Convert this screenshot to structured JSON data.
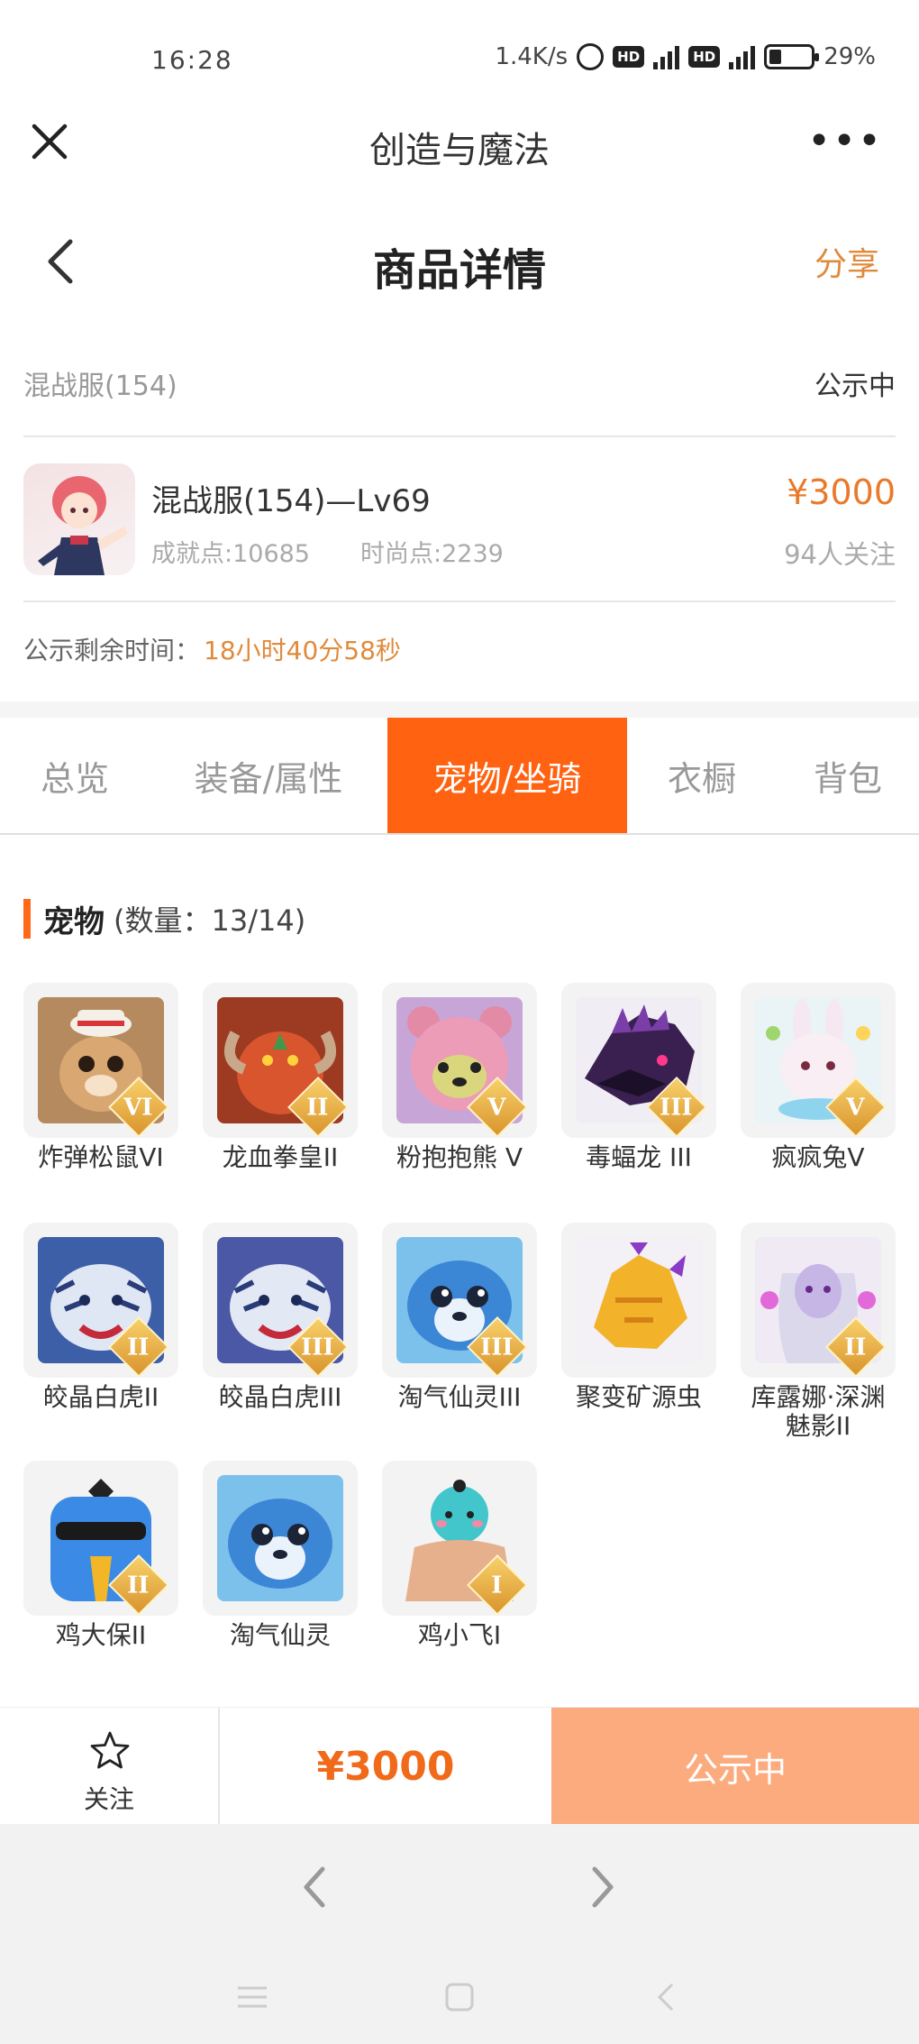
{
  "status_bar": {
    "time": "16:28",
    "network_speed": "1.4K/s",
    "hd1": "HD",
    "hd2": "HD",
    "battery": "29%",
    "battery_level": 0.29,
    "icons": [
      "alarm-icon",
      "signal-icon",
      "battery-icon"
    ]
  },
  "title_bar": {
    "title": "创造与魔法",
    "more": "•••"
  },
  "nav": {
    "title": "商品详情",
    "share": "分享"
  },
  "server": {
    "name": "混战服(154)",
    "status": "公示中"
  },
  "item": {
    "name": "混战服(154)—Lv69",
    "achievement": "成就点:10685",
    "fashion": "时尚点:2239",
    "price": "¥3000",
    "followers": "94人关注"
  },
  "remaining": {
    "label": "公示剩余时间：",
    "value": "18小时40分58秒"
  },
  "tabs": [
    {
      "label": "总览",
      "active": false
    },
    {
      "label": "装备/属性",
      "active": false
    },
    {
      "label": "宠物/坐骑",
      "active": true
    },
    {
      "label": "衣橱",
      "active": false
    },
    {
      "label": "背包",
      "active": false
    }
  ],
  "section": {
    "title": "宠物",
    "count": "(数量：13/14)"
  },
  "pets": [
    {
      "name": "炸弹松鼠VI",
      "badge": "VI"
    },
    {
      "name": "龙血拳皇II",
      "badge": "II"
    },
    {
      "name": "粉抱抱熊 V",
      "badge": "V"
    },
    {
      "name": "毒蝠龙 III",
      "badge": "III"
    },
    {
      "name": "疯疯兔V",
      "badge": "V"
    },
    {
      "name": "皎晶白虎II",
      "badge": "II"
    },
    {
      "name": "皎晶白虎III",
      "badge": "III"
    },
    {
      "name": "淘气仙灵III",
      "badge": "III"
    },
    {
      "name": "聚变矿源虫",
      "badge": ""
    },
    {
      "name": "库露娜·深渊魅影II",
      "badge": "II"
    },
    {
      "name": "鸡大保II",
      "badge": "II"
    },
    {
      "name": "淘气仙灵",
      "badge": ""
    },
    {
      "name": "鸡小飞I",
      "badge": "I"
    }
  ],
  "bottom_bar": {
    "follow": "关注",
    "price": "¥3000",
    "status": "公示中"
  },
  "colors": {
    "accent": "#ff6210",
    "price": "#e97a2c",
    "status_button": "#fbab7e"
  }
}
